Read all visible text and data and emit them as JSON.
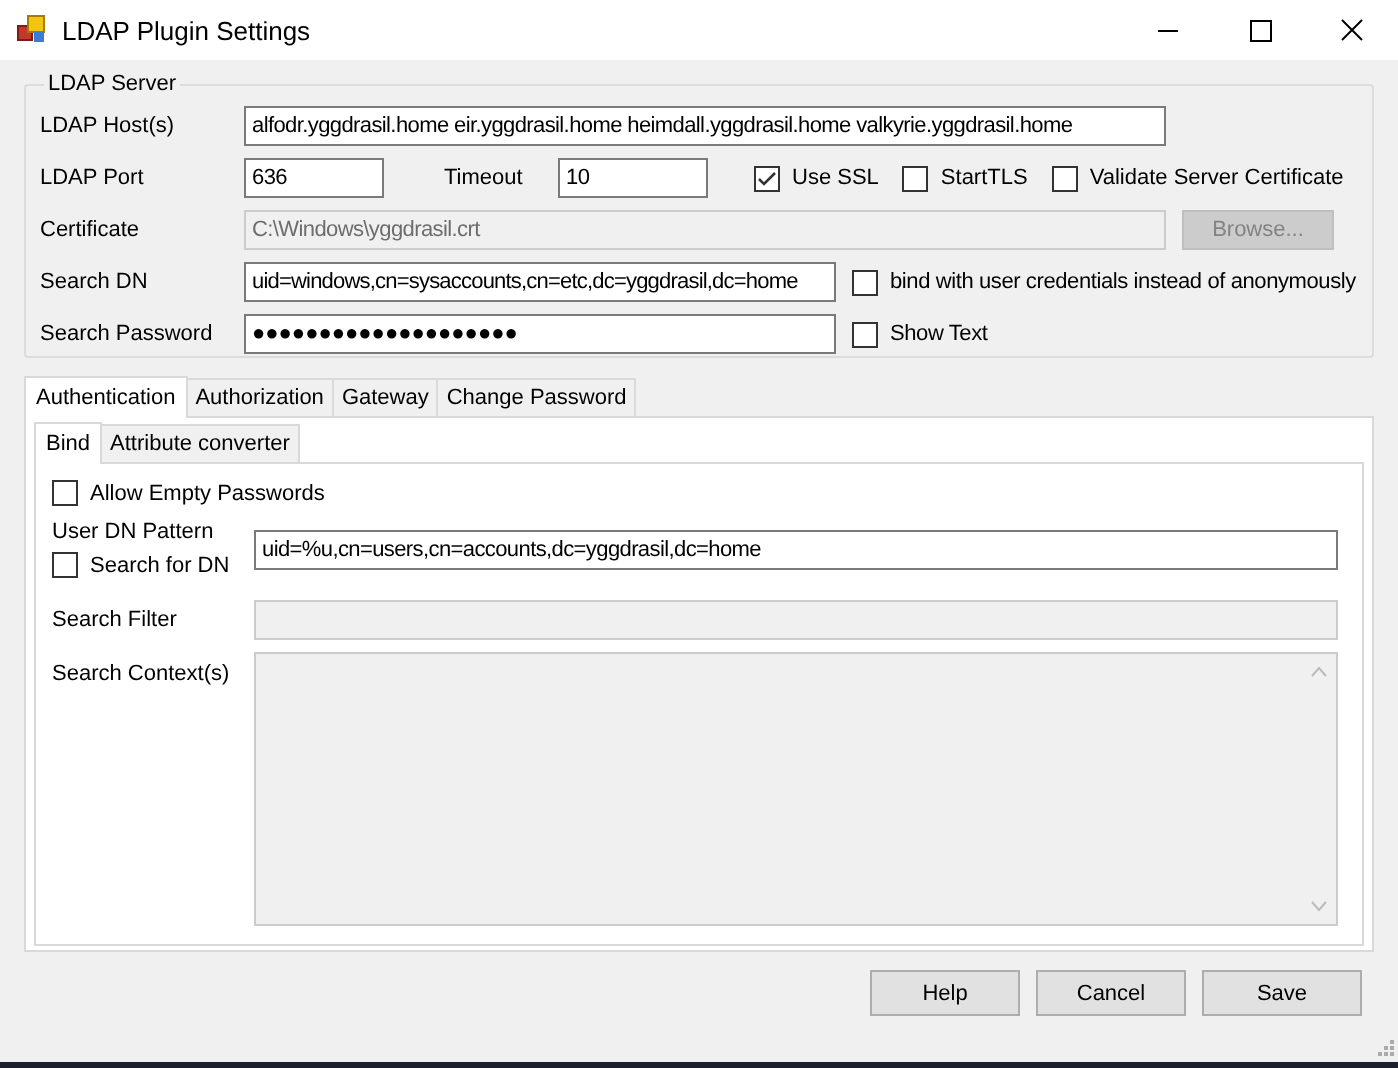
{
  "window": {
    "title": "LDAP Plugin Settings"
  },
  "ldap_server": {
    "legend": "LDAP Server",
    "host": {
      "label": "LDAP Host(s)",
      "value": "alfodr.yggdrasil.home eir.yggdrasil.home heimdall.yggdrasil.home valkyrie.yggdrasil.home"
    },
    "port": {
      "label": "LDAP Port",
      "value": "636"
    },
    "timeout": {
      "label": "Timeout",
      "value": "10"
    },
    "options": [
      {
        "label": "Use SSL",
        "checked": true
      },
      {
        "label": "StartTLS",
        "checked": false
      },
      {
        "label": "Validate Server Certificate",
        "checked": false
      }
    ],
    "certificate": {
      "label": "Certificate",
      "value": "C:\\Windows\\yggdrasil.crt",
      "disabled": true
    },
    "browse_button": {
      "label": "Browse...",
      "disabled": true
    },
    "search_dn": {
      "label": "Search DN",
      "value": "uid=windows,cn=sysaccounts,cn=etc,dc=yggdrasil,dc=home"
    },
    "bind_user": {
      "label": "bind with user credentials instead of anonymously",
      "checked": false
    },
    "search_password": {
      "label": "Search Password",
      "value": "●●●●●●●●●●●●●●●●●●●●"
    },
    "show_text": {
      "label": "Show Text",
      "checked": false
    }
  },
  "tabs": [
    {
      "label": "Authentication",
      "selected": true
    },
    {
      "label": "Authorization",
      "selected": false
    },
    {
      "label": "Gateway",
      "selected": false
    },
    {
      "label": "Change Password",
      "selected": false
    }
  ],
  "subtabs": [
    {
      "label": "Bind",
      "selected": true
    },
    {
      "label": "Attribute converter",
      "selected": false
    }
  ],
  "bind": {
    "allow_empty": {
      "label": "Allow Empty Passwords",
      "checked": false
    },
    "user_dn_pattern": {
      "label": "User DN Pattern",
      "value": "uid=%u,cn=users,cn=accounts,dc=yggdrasil,dc=home"
    },
    "search_for_dn": {
      "label": "Search for DN",
      "checked": false
    },
    "search_filter": {
      "label": "Search Filter",
      "disabled": true
    },
    "search_context": {
      "label": "Search Context(s)",
      "disabled": true
    }
  },
  "buttons": [
    "Help",
    "Cancel",
    "Save"
  ]
}
